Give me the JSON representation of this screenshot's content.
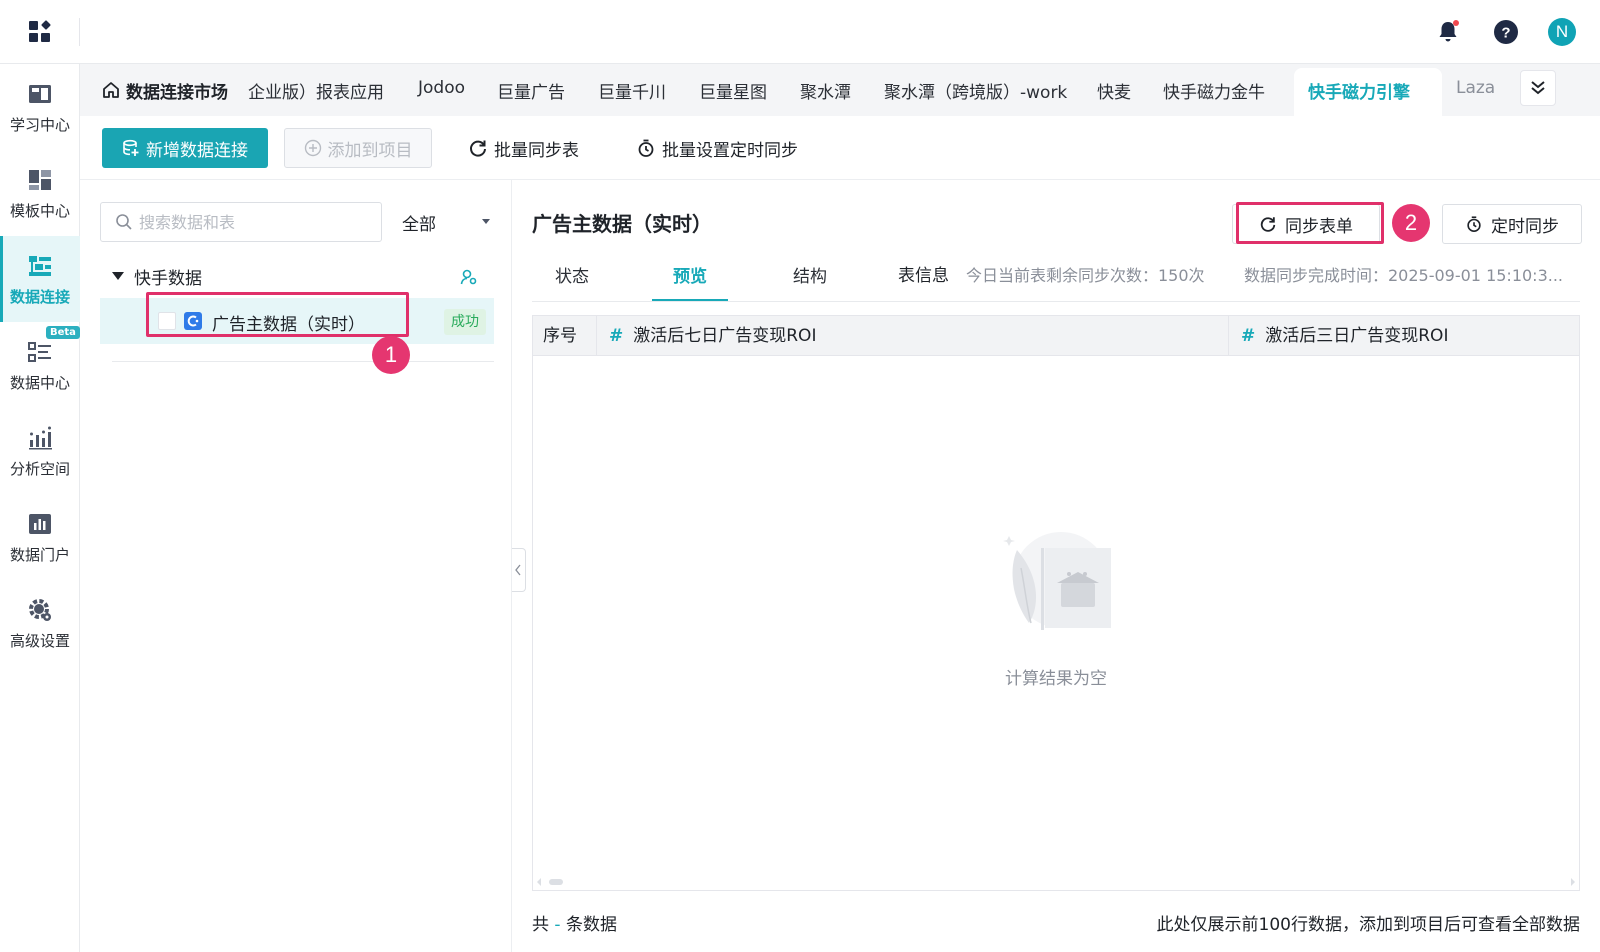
{
  "topbar": {
    "icons": [
      "apps-grid-icon",
      "bell-icon",
      "help-icon",
      "user-avatar"
    ],
    "avatar_initial": "N",
    "avatar_color": "#10a3b5",
    "notification_dot_color": "#f0474e"
  },
  "leftnav": {
    "items": [
      {
        "label": "学习中心",
        "icon": "learning-center-icon"
      },
      {
        "label": "模板中心",
        "icon": "template-center-icon"
      },
      {
        "label": "数据连接",
        "icon": "data-connection-icon",
        "active": true
      },
      {
        "label": "数据中心",
        "icon": "data-center-icon",
        "badge": "Beta"
      },
      {
        "label": "分析空间",
        "icon": "analysis-space-icon"
      },
      {
        "label": "数据门户",
        "icon": "data-portal-icon"
      },
      {
        "label": "高级设置",
        "icon": "advanced-settings-icon"
      }
    ]
  },
  "tabs": {
    "home": "数据连接市场",
    "items": [
      "企业版）报表应用",
      "Jodoo",
      "巨量广告",
      "巨量千川",
      "巨量星图",
      "聚水潭",
      "聚水潭（跨境版）-work",
      "快麦",
      "快手磁力金牛"
    ],
    "active": "快手磁力引擎",
    "partial": "Laza"
  },
  "toolbar": {
    "new_connection": "新增数据连接",
    "add_to_project": "添加到项目",
    "batch_sync": "批量同步表",
    "batch_schedule": "批量设置定时同步"
  },
  "leftpanel": {
    "search_placeholder": "搜索数据和表",
    "filter_value": "全部",
    "group": "快手数据",
    "row": {
      "name": "广告主数据（实时）",
      "status": "成功"
    }
  },
  "rightpanel": {
    "title": "广告主数据（实时）",
    "sync_button": "同步表单",
    "schedule_button": "定时同步",
    "subtabs": [
      "状态",
      "预览",
      "结构"
    ],
    "active_subtab": "预览",
    "info_label": "表信息",
    "remaining_sync": "今日当前表剩余同步次数：150次",
    "sync_time": "数据同步完成时间：2025-09-01 15:10:3..."
  },
  "table": {
    "columns": [
      "序号",
      "激活后七日广告变现ROI",
      "激活后三日广告变现ROI"
    ],
    "empty_text": "计算结果为空"
  },
  "footer": {
    "count_prefix": "共",
    "count_value": "-",
    "count_suffix": "条数据",
    "note": "此处仅展示前100行数据，添加到项目后可查看全部数据"
  },
  "annotations": {
    "badge_1": "1",
    "badge_2": "2",
    "highlight_color": "#e0306a"
  },
  "colors": {
    "accent": "#18a9b8",
    "primary_button": "#1aa5b3",
    "success_text": "#2bab5c"
  }
}
